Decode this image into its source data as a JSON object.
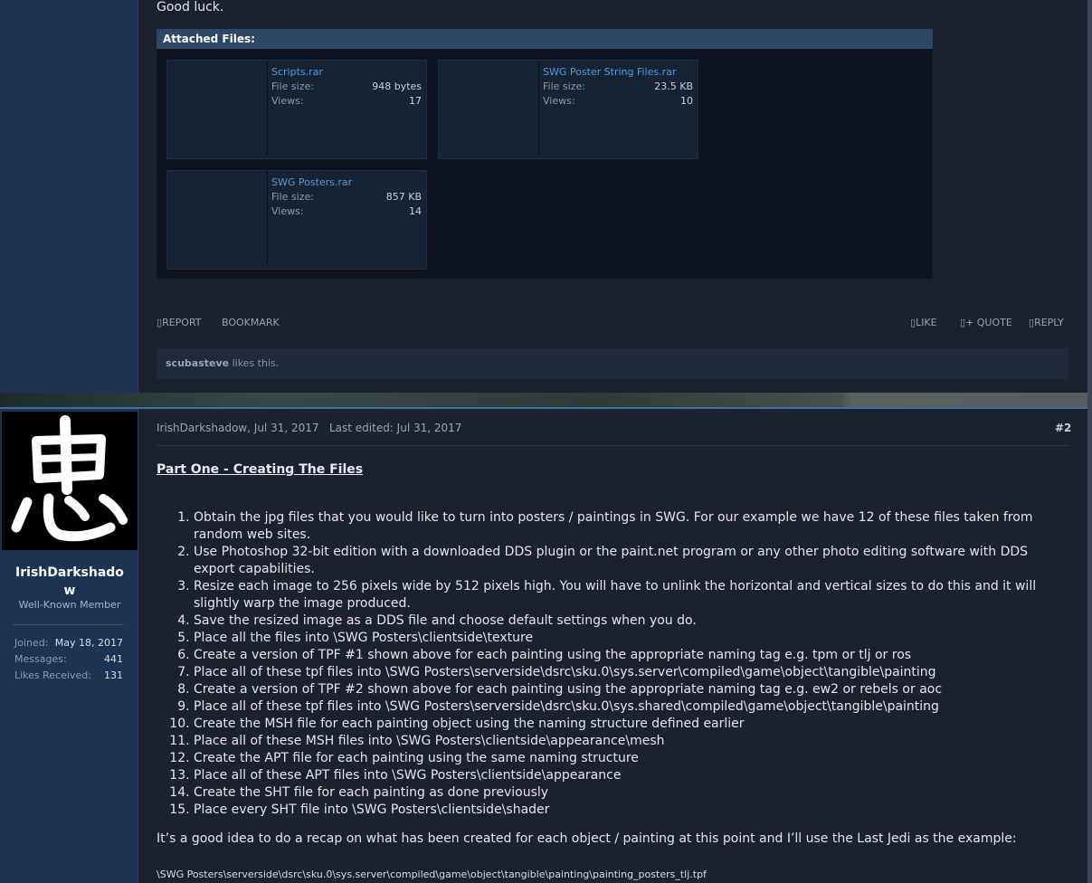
{
  "post1": {
    "closing_text": "Good luck.",
    "attachments_title": "Attached Files:",
    "attachments": [
      {
        "name": "Scripts.rar",
        "size_label": "File size:",
        "size": "948 bytes",
        "views_label": "Views:",
        "views": "17"
      },
      {
        "name": "SWG Poster String Files.rar",
        "size_label": "File size:",
        "size": "23.5 KB",
        "views_label": "Views:",
        "views": "10"
      },
      {
        "name": "SWG Posters.rar",
        "size_label": "File size:",
        "size": "857 KB",
        "views_label": "Views:",
        "views": "14"
      }
    ],
    "actions": {
      "report": "REPORT",
      "bookmark": "BOOKMARK",
      "like": "LIKE",
      "quote": "+ QUOTE",
      "reply": "REPLY"
    },
    "likes_user": "scubasteve",
    "likes_text": "likes this."
  },
  "post2": {
    "author": "IrishDarkshadow",
    "user_title": "Well-Known Member",
    "stats": [
      {
        "label": "Joined:",
        "value": "May 18, 2017"
      },
      {
        "label": "Messages:",
        "value": "441"
      },
      {
        "label": "Likes Received:",
        "value": "131"
      }
    ],
    "meta_author": "IrishDarkshadow,",
    "meta_date": "Jul 31, 2017",
    "meta_edited": "Last edited: Jul 31, 2017",
    "post_number": "#2",
    "section_title": "Part One - Creating The Files",
    "steps": [
      "Obtain the jpg files that you would like to turn into posters / paintings in SWG. For our example we have 12 of these files taken from random web sites.",
      "Use Photoshop 32-bit edition with a downloaded DDS plugin or the paint.net program or any other photo editing software with DDS export capabilities.",
      "Resize each image to 256 pixels wide by 512 pixels high. You will have to unlink the horizontal and vertical sizes to do this and it will slightly warp the image produced.",
      "Save the resized image as a DDS file and choose default settings when you do.",
      "Place all the files into \\SWG Posters\\clientside\\texture",
      "Create a version of TPF #1 shown above for each painting using the appropriate naming tag e.g. tpm or tlj or ros",
      "Place all of these tpf files into \\SWG Posters\\serverside\\dsrc\\sku.0\\sys.server\\compiled\\game\\object\\tangible\\painting",
      "Create a version of TPF #2 shown above for each painting using the appropriate naming tag e.g. ew2 or rebels or aoc",
      "Place all of these tpf files into \\SWG Posters\\serverside\\dsrc\\sku.0\\sys.shared\\compiled\\game\\object\\tangible\\painting",
      "Create the MSH file for each painting object using the naming structure defined earlier",
      "Place all of these MSH files into \\SWG Posters\\clientside\\appearance\\mesh",
      "Create the APT file for each painting using the same naming structure",
      "Place all of these APT files into \\SWG Posters\\clientside\\appearance",
      "Create the SHT file for each painting as done previously",
      "Place every SHT file into \\SWG Posters\\clientside\\shader"
    ],
    "recap": "It’s a good idea to do a recap on what has been created for each object / painting at this point and I’ll use the Last Jedi as the example:",
    "path_line": "\\SWG Posters\\serverside\\dsrc\\sku.0\\sys.server\\compiled\\game\\object\\tangible\\painting\\painting_posters_tlj.tpf"
  },
  "icons": {
    "avatar": "kanji-chu-avatar",
    "action_glyph": "box-glyph"
  }
}
